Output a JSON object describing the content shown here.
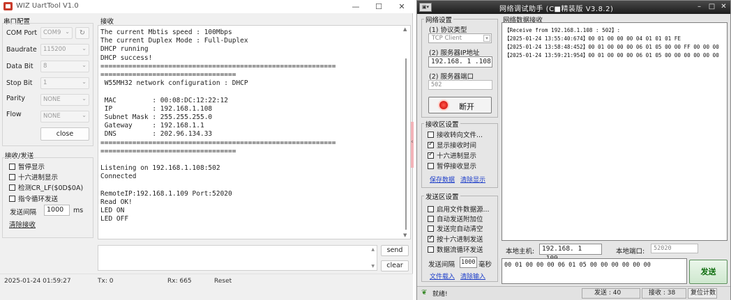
{
  "wiz": {
    "title": "WIZ UartTool V1.0",
    "serial_group": "串口配置",
    "fields": [
      {
        "label": "COM Port",
        "value": "COM9"
      },
      {
        "label": "Baudrate",
        "value": "115200"
      },
      {
        "label": "Data Bit",
        "value": "8"
      },
      {
        "label": "Stop Bit",
        "value": "1"
      },
      {
        "label": "Parity",
        "value": "NONE"
      },
      {
        "label": "Flow",
        "value": "NONE"
      }
    ],
    "close_label": "close",
    "rxtx_group": "接收/发送",
    "checks": [
      {
        "label": "暂停显示",
        "checked": false
      },
      {
        "label": "十六进制显示",
        "checked": false
      },
      {
        "label": "检测CR_LF($0D$0A)",
        "checked": false
      },
      {
        "label": "指令循环发送",
        "checked": false
      }
    ],
    "interval_label": "发送间隔",
    "interval_value": "1000",
    "interval_unit": "ms",
    "clear_recv": "清除接收",
    "receive_label": "接收",
    "receive_text": "The current Mbtis speed : 100Mbps\nThe current Duplex Mode : Full-Duplex\nDHCP running\nDHCP success!\n===========================================================\n==================================\n W55MH32 network configuration : DHCP\n\n MAC         : 00:08:DC:12:22:12\n IP          : 192.168.1.108\n Subnet Mask : 255.255.255.0\n Gateway     : 192.168.1.1\n DNS         : 202.96.134.33\n===========================================================\n==================================\n\nListening on 192.168.1.108:502\nConnected\n\nRemoteIP:192.168.1.109 Port:52020\nRead OK!\nLED ON\nLED OFF",
    "send_label": "send",
    "clear_label": "clear",
    "status": {
      "time": "2025-01-24 01:59:27",
      "tx": "Tx: 0",
      "rx": "Rx: 665",
      "reset": "Reset"
    }
  },
  "net": {
    "title": "网络调试助手 (C■精装版 V3.8.2)",
    "settings_group": "网络设置",
    "protocol_label": "(1) 协议类型",
    "protocol_value": "TCP Client",
    "ip_label": "(2) 服务器IP地址",
    "ip_value": "192.168. 1 .108",
    "port_label": "(2) 服务器端口",
    "port_value": "502",
    "disconnect_label": "断开",
    "recv_settings_group": "接收区设置",
    "recv_checks": [
      {
        "label": "接收转向文件...",
        "checked": false
      },
      {
        "label": "显示接收时间",
        "checked": true
      },
      {
        "label": "十六进制显示",
        "checked": true
      },
      {
        "label": "暂停接收显示",
        "checked": false
      }
    ],
    "save_data": "保存数据",
    "clear_display": "清除显示",
    "send_settings_group": "发送区设置",
    "send_checks": [
      {
        "label": "启用文件数据源...",
        "checked": false
      },
      {
        "label": "自动发送附加位",
        "checked": false
      },
      {
        "label": "发送完自动清空",
        "checked": false
      },
      {
        "label": "按十六进制发送",
        "checked": true
      },
      {
        "label": "数据流循环发送",
        "checked": false
      }
    ],
    "interval_label": "发送间隔",
    "interval_value": "1000",
    "interval_unit": "毫秒",
    "file_load": "文件载入",
    "clear_input": "清除输入",
    "recv_group": "网络数据接收",
    "recv_lines": [
      "【Receive from 192.168.1.108 : 502】:",
      "【2025-01-24 13:55:40:674】00 01 00 00 00 04 01 01 01 FE",
      "【2025-01-24 13:58:48:452】00 01 00 00 00 06 01 05 00 00 FF 00 00 00",
      "【2025-01-24 13:59:21:954】00 01 00 00 00 06 01 05 00 00 00 00 00 00"
    ],
    "local_host_label": "本地主机:",
    "local_host_value": "192.168. 1 .109",
    "local_port_label": "本地端口:",
    "local_port_value": "52020",
    "send_text": "00 01 00 00 00 06 01 05 00 00 00 00 00 00",
    "send_label": "发送",
    "status": {
      "ready": "就绪!",
      "sent": "发送 : 40",
      "received": "接收 : 38",
      "reset": "复位计数"
    }
  }
}
